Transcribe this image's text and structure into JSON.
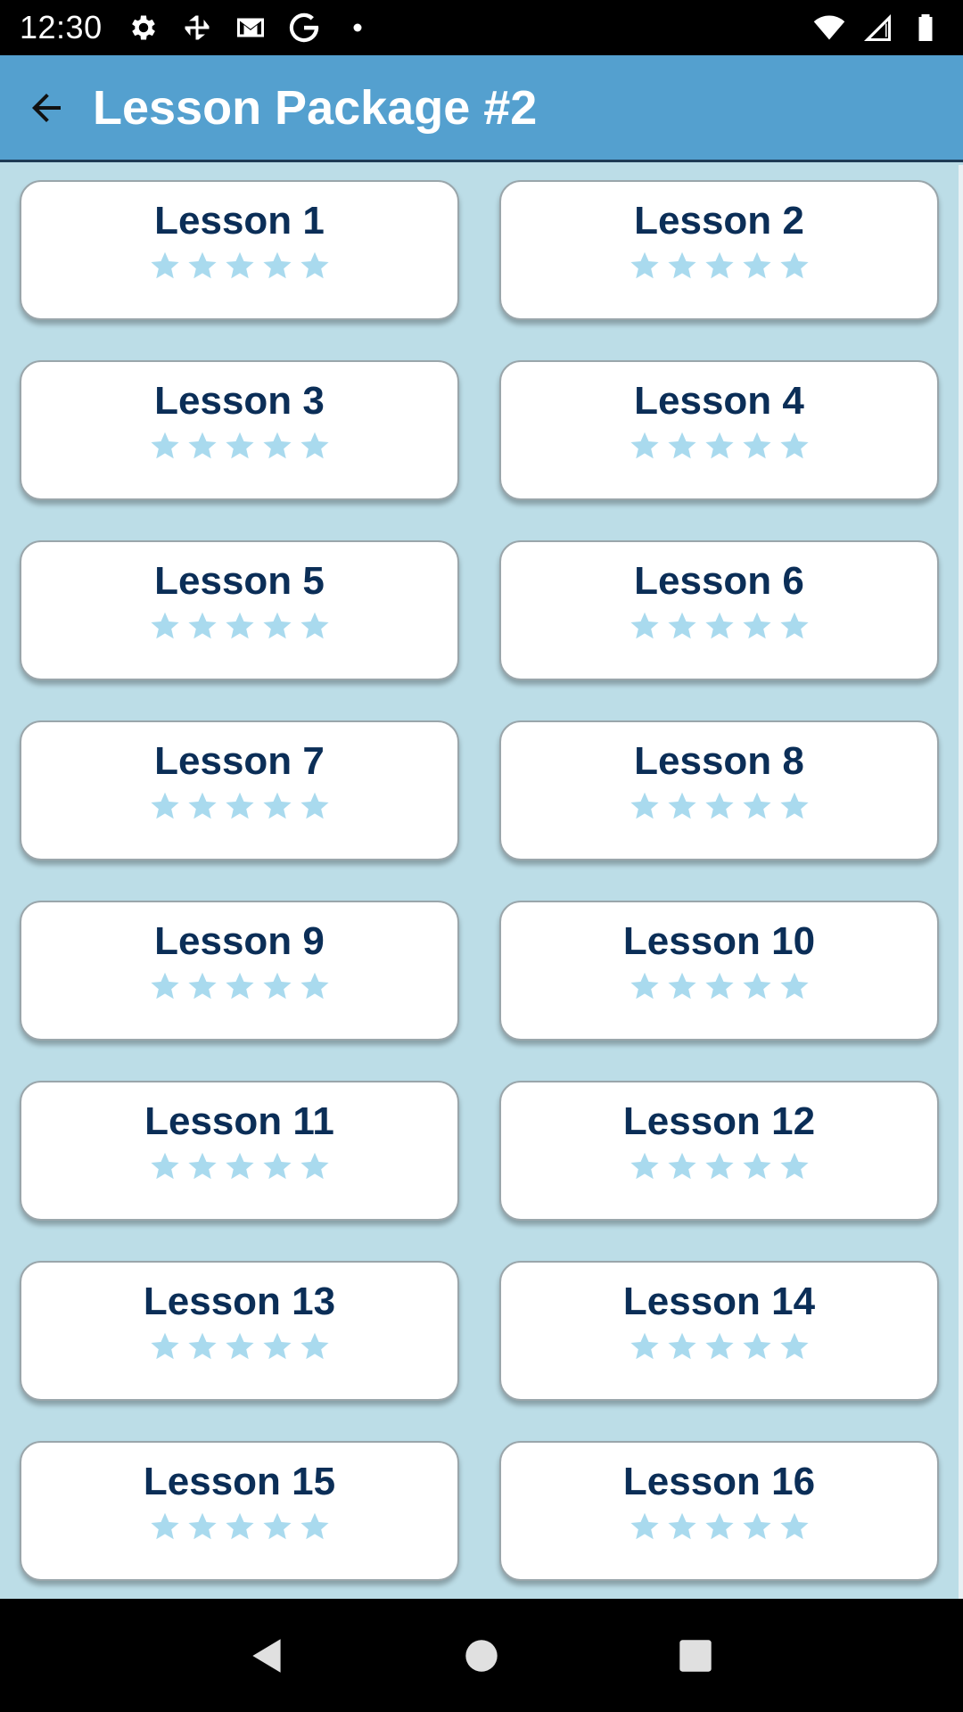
{
  "status_bar": {
    "time": "12:30",
    "left_icons": [
      "gear-icon",
      "pinwheel-icon",
      "gmail-icon",
      "google-g-icon",
      "dot-icon"
    ],
    "right_icons": [
      "wifi-icon",
      "signal-icon",
      "battery-icon"
    ]
  },
  "app_bar": {
    "back_icon": "arrow-back-icon",
    "title": "Lesson Package #2",
    "color": "#54a0cf"
  },
  "colors": {
    "background": "#bcdde7",
    "card_title": "#0b2e57",
    "star": "#a9daee"
  },
  "lessons": [
    {
      "title": "Lesson 1",
      "stars_filled": 0,
      "stars_total": 5
    },
    {
      "title": "Lesson 2",
      "stars_filled": 0,
      "stars_total": 5
    },
    {
      "title": "Lesson 3",
      "stars_filled": 0,
      "stars_total": 5
    },
    {
      "title": "Lesson 4",
      "stars_filled": 0,
      "stars_total": 5
    },
    {
      "title": "Lesson 5",
      "stars_filled": 0,
      "stars_total": 5
    },
    {
      "title": "Lesson 6",
      "stars_filled": 0,
      "stars_total": 5
    },
    {
      "title": "Lesson 7",
      "stars_filled": 0,
      "stars_total": 5
    },
    {
      "title": "Lesson 8",
      "stars_filled": 0,
      "stars_total": 5
    },
    {
      "title": "Lesson 9",
      "stars_filled": 0,
      "stars_total": 5
    },
    {
      "title": "Lesson 10",
      "stars_filled": 0,
      "stars_total": 5
    },
    {
      "title": "Lesson 11",
      "stars_filled": 0,
      "stars_total": 5
    },
    {
      "title": "Lesson 12",
      "stars_filled": 0,
      "stars_total": 5
    },
    {
      "title": "Lesson 13",
      "stars_filled": 0,
      "stars_total": 5
    },
    {
      "title": "Lesson 14",
      "stars_filled": 0,
      "stars_total": 5
    },
    {
      "title": "Lesson 15",
      "stars_filled": 0,
      "stars_total": 5
    },
    {
      "title": "Lesson 16",
      "stars_filled": 0,
      "stars_total": 5
    }
  ],
  "nav_bar": {
    "buttons": [
      "back-triangle-icon",
      "home-circle-icon",
      "recents-square-icon"
    ]
  }
}
